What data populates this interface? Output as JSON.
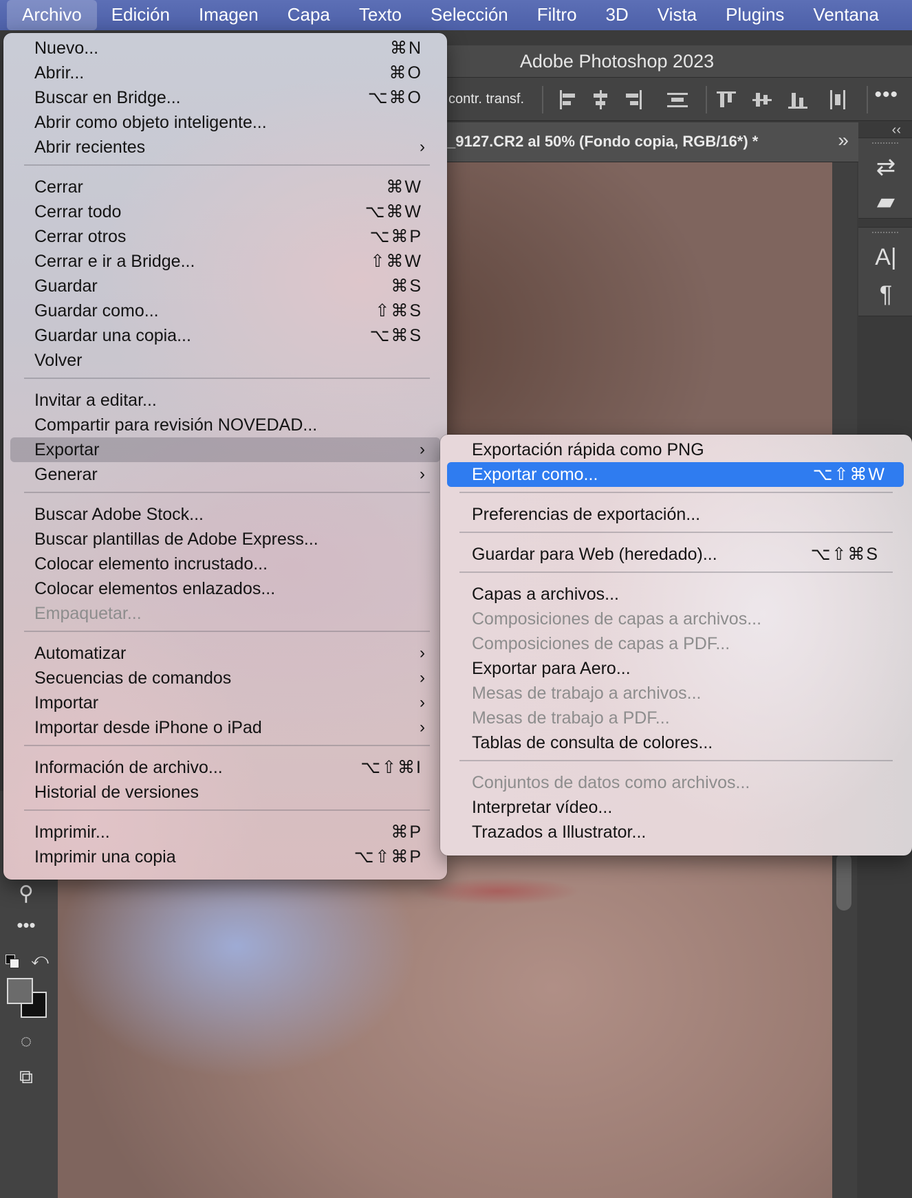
{
  "menubar": {
    "items": [
      "Archivo",
      "Edición",
      "Imagen",
      "Capa",
      "Texto",
      "Selección",
      "Filtro",
      "3D",
      "Vista",
      "Plugins",
      "Ventana"
    ],
    "active": "Archivo"
  },
  "window": {
    "title": "Adobe Photoshop 2023",
    "options_label": "contr. transf.",
    "more_label": "•••",
    "tab_name": "_9127.CR2 al 50% (Fondo copia, RGB/16*) *",
    "tab_chevron": "»",
    "collapse_label": "‹‹"
  },
  "archivo_menu": {
    "groups": [
      [
        {
          "label": "Nuevo...",
          "shortcut": "⌘N"
        },
        {
          "label": "Abrir...",
          "shortcut": "⌘O"
        },
        {
          "label": "Buscar en Bridge...",
          "shortcut": "⌥⌘O"
        },
        {
          "label": "Abrir como objeto inteligente...",
          "shortcut": ""
        },
        {
          "label": "Abrir recientes",
          "submenu": true
        }
      ],
      [
        {
          "label": "Cerrar",
          "shortcut": "⌘W"
        },
        {
          "label": "Cerrar todo",
          "shortcut": "⌥⌘W"
        },
        {
          "label": "Cerrar otros",
          "shortcut": "⌥⌘P"
        },
        {
          "label": "Cerrar e ir a Bridge...",
          "shortcut": "⇧⌘W"
        },
        {
          "label": "Guardar",
          "shortcut": "⌘S"
        },
        {
          "label": "Guardar como...",
          "shortcut": "⇧⌘S"
        },
        {
          "label": "Guardar una copia...",
          "shortcut": "⌥⌘S"
        },
        {
          "label": "Volver",
          "shortcut": ""
        }
      ],
      [
        {
          "label": "Invitar a editar...",
          "shortcut": ""
        },
        {
          "label": "Compartir para revisión NOVEDAD...",
          "shortcut": ""
        },
        {
          "label": "Exportar",
          "submenu": true,
          "highlighted": true
        },
        {
          "label": "Generar",
          "submenu": true
        }
      ],
      [
        {
          "label": "Buscar Adobe Stock...",
          "shortcut": ""
        },
        {
          "label": "Buscar plantillas de Adobe Express...",
          "shortcut": ""
        },
        {
          "label": "Colocar elemento incrustado...",
          "shortcut": ""
        },
        {
          "label": "Colocar elementos enlazados...",
          "shortcut": ""
        },
        {
          "label": "Empaquetar...",
          "shortcut": "",
          "disabled": true
        }
      ],
      [
        {
          "label": "Automatizar",
          "submenu": true
        },
        {
          "label": "Secuencias de comandos",
          "submenu": true
        },
        {
          "label": "Importar",
          "submenu": true
        },
        {
          "label": "Importar desde iPhone o iPad",
          "submenu": true
        }
      ],
      [
        {
          "label": "Información de archivo...",
          "shortcut": "⌥⇧⌘I"
        },
        {
          "label": "Historial de versiones",
          "shortcut": ""
        }
      ],
      [
        {
          "label": "Imprimir...",
          "shortcut": "⌘P"
        },
        {
          "label": "Imprimir una copia",
          "shortcut": "⌥⇧⌘P"
        }
      ]
    ]
  },
  "exportar_submenu": {
    "groups": [
      [
        {
          "label": "Exportación rápida como PNG",
          "shortcut": ""
        },
        {
          "label": "Exportar como...",
          "shortcut": "⌥⇧⌘W",
          "selected": true
        }
      ],
      [
        {
          "label": "Preferencias de exportación...",
          "shortcut": ""
        }
      ],
      [
        {
          "label": "Guardar para Web (heredado)...",
          "shortcut": "⌥⇧⌘S"
        }
      ],
      [
        {
          "label": "Capas a archivos...",
          "shortcut": ""
        },
        {
          "label": "Composiciones de capas a archivos...",
          "shortcut": "",
          "disabled": true
        },
        {
          "label": "Composiciones de capas a PDF...",
          "shortcut": "",
          "disabled": true
        },
        {
          "label": "Exportar para Aero...",
          "shortcut": ""
        },
        {
          "label": "Mesas de trabajo a archivos...",
          "shortcut": "",
          "disabled": true
        },
        {
          "label": "Mesas de trabajo a PDF...",
          "shortcut": "",
          "disabled": true
        },
        {
          "label": "Tablas de consulta de colores...",
          "shortcut": ""
        }
      ],
      [
        {
          "label": "Conjuntos de datos como archivos...",
          "shortcut": "",
          "disabled": true
        },
        {
          "label": "Interpretar vídeo...",
          "shortcut": ""
        },
        {
          "label": "Trazados a Illustrator...",
          "shortcut": ""
        }
      ]
    ]
  },
  "icons": {
    "submenu_arrow": "›",
    "right_panel": [
      "history-brush-icon",
      "comment-icon",
      "character-icon",
      "paragraph-icon"
    ],
    "left_tools": [
      "zoom-icon",
      "more-tools-icon",
      "swap-colors-icon",
      "quick-mask-icon",
      "screen-mode-icon"
    ]
  },
  "colors": {
    "menubar": "#5468b0",
    "selection": "#2f7cf0",
    "hover": "#7d7882"
  }
}
